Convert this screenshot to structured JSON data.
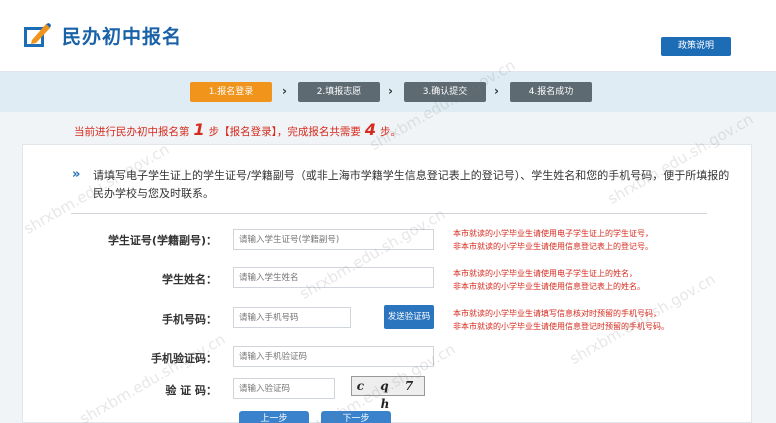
{
  "header": {
    "title": "民办初中报名",
    "policy_button": "政策说明"
  },
  "steps": [
    {
      "label": "1.报名登录",
      "active": true
    },
    {
      "label": "2.填报志愿",
      "active": false
    },
    {
      "label": "3.确认提交",
      "active": false
    },
    {
      "label": "4.报名成功",
      "active": false
    }
  ],
  "notice": {
    "prefix": "当前进行民办初中报名第",
    "current_step": "1",
    "middle": "步【报名登录】，完成报名共需要",
    "total_steps": "4",
    "suffix": "步。"
  },
  "intro": "请填写电子学生证上的学生证号/学籍副号（或非上海市学籍学生信息登记表上的登记号）、学生姓名和您的手机号码，便于所填报的民办学校与您及时联系。",
  "form": {
    "student_id": {
      "label": "学生证号(学籍副号)：",
      "placeholder": "请输入学生证号(学籍副号)",
      "hint_1": "本市就读的小学毕业生请使用电子学生证上的学生证号，",
      "hint_2": "非本市就读的小学毕业生请使用信息登记表上的登记号。"
    },
    "student_name": {
      "label": "学生姓名：",
      "placeholder": "请输入学生姓名",
      "hint_1": "本市就读的小学毕业生请使用电子学生证上的姓名，",
      "hint_2": "非本市就读的小学毕业生请使用信息登记表上的姓名。"
    },
    "phone": {
      "label": "手机号码：",
      "placeholder": "请输入手机号码",
      "send_button": "发送验证码",
      "hint_1": "本市就读的小学毕业生请填写信息核对时预留的手机号码，",
      "hint_2": "非本市就读的小学毕业生请使用信息登记时预留的手机号码。"
    },
    "phone_code": {
      "label": "手机验证码：",
      "placeholder": "请输入手机验证码"
    },
    "captcha": {
      "label": "验 证 码：",
      "placeholder": "请输入验证码",
      "image_text": "c q 7 h"
    }
  },
  "buttons": {
    "prev": "上一步",
    "next": "下一步"
  },
  "watermark": "shrxbm.edu.sh.gov.cn"
}
